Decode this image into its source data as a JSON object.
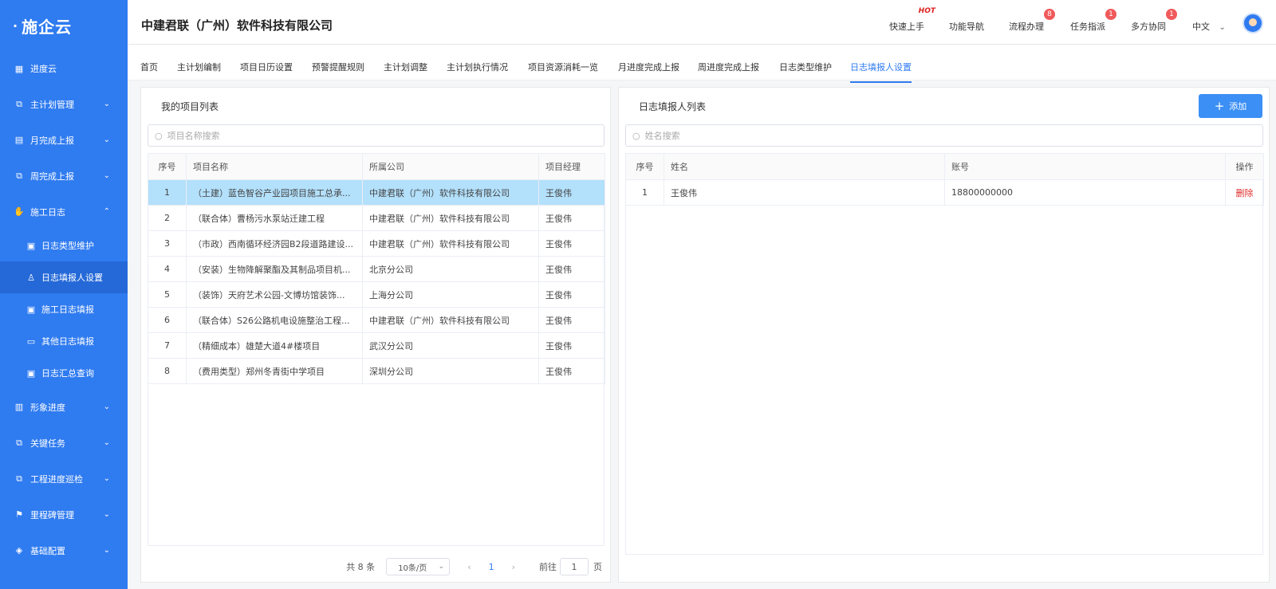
{
  "sidebar": {
    "logo": "施企云",
    "top_item": "进度云",
    "items": [
      {
        "label": "主计划管理",
        "icon": "org-chart-icon"
      },
      {
        "label": "月完成上报",
        "icon": "clipboard-icon"
      },
      {
        "label": "周完成上报",
        "icon": "org-chart-icon"
      },
      {
        "label": "施工日志",
        "icon": "hand-icon"
      }
    ],
    "sub_items": [
      {
        "label": "日志类型维护",
        "icon": "doc-icon"
      },
      {
        "label": "日志填报人设置",
        "icon": "user-icon"
      },
      {
        "label": "施工日志填报",
        "icon": "doc-icon"
      },
      {
        "label": "其他日志填报",
        "icon": "picture-icon"
      },
      {
        "label": "日志汇总查询",
        "icon": "doc-search-icon"
      }
    ],
    "items_after": [
      {
        "label": "形象进度",
        "icon": "stack-icon"
      },
      {
        "label": "关键任务",
        "icon": "org-chart-icon"
      },
      {
        "label": "工程进度巡检",
        "icon": "org-chart-icon"
      },
      {
        "label": "里程碑管理",
        "icon": "flag-icon"
      },
      {
        "label": "基础配置",
        "icon": "layers-icon"
      }
    ]
  },
  "header": {
    "company": "中建君联（广州）软件科技有限公司",
    "quick_start": "快速上手",
    "hot": "HOT",
    "nav_guide": "功能导航",
    "process": "流程办理",
    "process_badge": "8",
    "task": "任务指派",
    "task_badge": "1",
    "collab": "多方协同",
    "collab_badge": "1",
    "language": "中文"
  },
  "tabs": [
    "首页",
    "主计划编制",
    "项目日历设置",
    "预警提醒规则",
    "主计划调整",
    "主计划执行情况",
    "项目资源消耗一览",
    "月进度完成上报",
    "周进度完成上报",
    "日志类型维护",
    "日志填报人设置"
  ],
  "left_panel": {
    "title": "我的项目列表",
    "search_placeholder": "项目名称搜索",
    "columns": [
      "序号",
      "项目名称",
      "所属公司",
      "项目经理"
    ],
    "rows": [
      [
        "1",
        "（土建）蓝色智谷产业园项目施工总承...",
        "中建君联（广州）软件科技有限公司",
        "王俊伟"
      ],
      [
        "2",
        "（联合体）曹杨污水泵站迁建工程",
        "中建君联（广州）软件科技有限公司",
        "王俊伟"
      ],
      [
        "3",
        "（市政）西南循环经济园B2段道路建设...",
        "中建君联（广州）软件科技有限公司",
        "王俊伟"
      ],
      [
        "4",
        "（安装）生物降解聚酯及其制品项目机...",
        "北京分公司",
        "王俊伟"
      ],
      [
        "5",
        "（装饰）天府艺术公园-文博坊馆装饰...",
        "上海分公司",
        "王俊伟"
      ],
      [
        "6",
        "（联合体）S26公路机电设施整治工程...",
        "中建君联（广州）软件科技有限公司",
        "王俊伟"
      ],
      [
        "7",
        "（精细成本）雄楚大道4#楼项目",
        "武汉分公司",
        "王俊伟"
      ],
      [
        "8",
        "（费用类型）郑州冬青街中学项目",
        "深圳分公司",
        "王俊伟"
      ]
    ],
    "pager": {
      "total": "共 8 条",
      "page_size": "10条/页",
      "current_page": "1",
      "goto_label": "前往",
      "goto_value": "1",
      "unit": "页"
    }
  },
  "right_panel": {
    "title": "日志填报人列表",
    "add_label": "添加",
    "search_placeholder": "姓名搜索",
    "columns": [
      "序号",
      "姓名",
      "账号",
      "操作"
    ],
    "rows": [
      {
        "no": "1",
        "name": "王俊伟",
        "account": "18800000000",
        "action": "删除"
      }
    ]
  },
  "colors": {
    "sidebar": "#2f7bf0",
    "accent": "#2f7bf0",
    "selected_row": "#b3e0fb",
    "danger": "#e02b2b"
  }
}
